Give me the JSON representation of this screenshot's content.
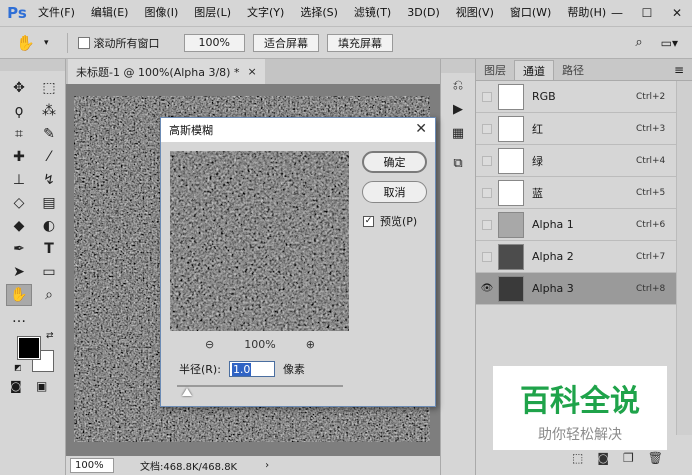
{
  "app": {
    "logo": "Ps"
  },
  "menu": [
    "文件(F)",
    "编辑(E)",
    "图像(I)",
    "图层(L)",
    "文字(Y)",
    "选择(S)",
    "滤镜(T)",
    "3D(D)",
    "视图(V)",
    "窗口(W)",
    "帮助(H)"
  ],
  "window_controls": {
    "minimize": "—",
    "maximize": "☐",
    "close": "✕"
  },
  "options": {
    "scroll_all_label": "滚动所有窗口",
    "zoom_value": "100%",
    "fit_screen": "适合屏幕",
    "fill_screen": "填充屏幕"
  },
  "document": {
    "tab_title": "未标题-1 @ 100%(Alpha 3/8) *",
    "tab_close": "×",
    "status_zoom": "100%",
    "status_doc": "文档:468.8K/468.8K",
    "status_arrow": "›"
  },
  "panel": {
    "tabs": [
      "图层",
      "通道",
      "路径"
    ],
    "active_tab": "通道",
    "channels": [
      {
        "name": "RGB",
        "shortcut": "Ctrl+2",
        "thumb": "#ffffff",
        "visible": false,
        "selected": false
      },
      {
        "name": "红",
        "shortcut": "Ctrl+3",
        "thumb": "#ffffff",
        "visible": false,
        "selected": false
      },
      {
        "name": "绿",
        "shortcut": "Ctrl+4",
        "thumb": "#ffffff",
        "visible": false,
        "selected": false
      },
      {
        "name": "蓝",
        "shortcut": "Ctrl+5",
        "thumb": "#ffffff",
        "visible": false,
        "selected": false
      },
      {
        "name": "Alpha 1",
        "shortcut": "Ctrl+6",
        "thumb": "#a8a8a8",
        "visible": false,
        "selected": false
      },
      {
        "name": "Alpha 2",
        "shortcut": "Ctrl+7",
        "thumb": "#4c4c4c",
        "visible": false,
        "selected": false
      },
      {
        "name": "Alpha 3",
        "shortcut": "Ctrl+8",
        "thumb": "#3a3a3a",
        "visible": true,
        "selected": true
      }
    ]
  },
  "dialog": {
    "title": "高斯模糊",
    "close": "✕",
    "ok": "确定",
    "cancel": "取消",
    "preview_label": "预览(P)",
    "preview_checked": true,
    "zoom_level": "100%",
    "radius_label": "半径(R):",
    "radius_value": "1.0",
    "radius_unit": "像素",
    "slider_fraction": 0.02
  },
  "watermark": {
    "main": "百科全说",
    "sub": "助你轻松解决"
  },
  "colors": {
    "accent": "#2f63c4",
    "brand": "#1fa34a",
    "foreground": "#000000",
    "background": "#ffffff"
  }
}
